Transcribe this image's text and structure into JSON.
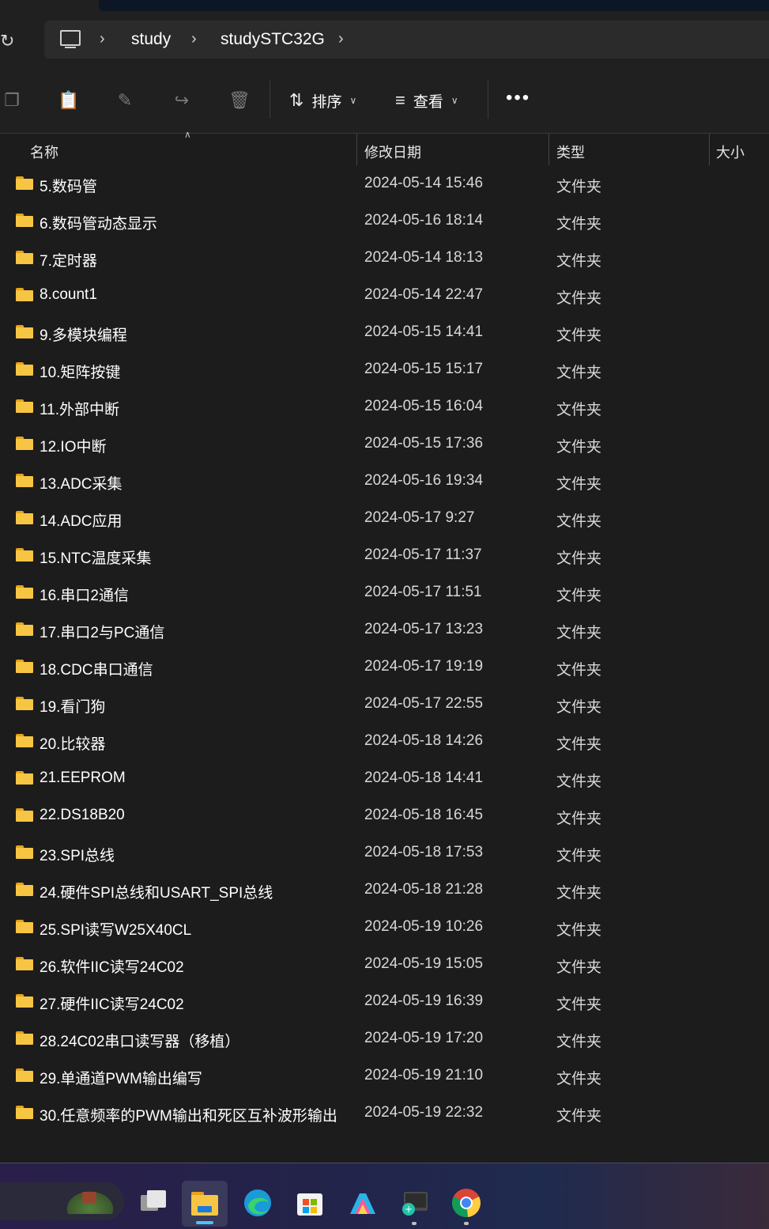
{
  "address": {
    "refresh_icon": "refresh-icon",
    "pc_icon": "computer-icon",
    "breadcrumbs": [
      "study",
      "studySTC32G"
    ]
  },
  "toolbar": {
    "sort_label": "排序",
    "view_label": "查看",
    "icons": [
      "copy-icon",
      "paste-icon",
      "rename-icon",
      "share-icon",
      "delete-icon"
    ]
  },
  "columns": {
    "name": "名称",
    "date": "修改日期",
    "type": "类型",
    "size": "大小"
  },
  "rows": [
    {
      "name": "5.数码管",
      "date": "2024-05-14 15:46",
      "type": "文件夹"
    },
    {
      "name": "6.数码管动态显示",
      "date": "2024-05-16 18:14",
      "type": "文件夹"
    },
    {
      "name": "7.定时器",
      "date": "2024-05-14 18:13",
      "type": "文件夹"
    },
    {
      "name": "8.count1",
      "date": "2024-05-14 22:47",
      "type": "文件夹"
    },
    {
      "name": "9.多模块编程",
      "date": "2024-05-15 14:41",
      "type": "文件夹"
    },
    {
      "name": "10.矩阵按键",
      "date": "2024-05-15 15:17",
      "type": "文件夹"
    },
    {
      "name": "11.外部中断",
      "date": "2024-05-15 16:04",
      "type": "文件夹"
    },
    {
      "name": "12.IO中断",
      "date": "2024-05-15 17:36",
      "type": "文件夹"
    },
    {
      "name": "13.ADC采集",
      "date": "2024-05-16 19:34",
      "type": "文件夹"
    },
    {
      "name": "14.ADC应用",
      "date": "2024-05-17 9:27",
      "type": "文件夹"
    },
    {
      "name": "15.NTC温度采集",
      "date": "2024-05-17 11:37",
      "type": "文件夹"
    },
    {
      "name": "16.串口2通信",
      "date": "2024-05-17 11:51",
      "type": "文件夹"
    },
    {
      "name": "17.串口2与PC通信",
      "date": "2024-05-17 13:23",
      "type": "文件夹"
    },
    {
      "name": "18.CDC串口通信",
      "date": "2024-05-17 19:19",
      "type": "文件夹"
    },
    {
      "name": "19.看门狗",
      "date": "2024-05-17 22:55",
      "type": "文件夹"
    },
    {
      "name": "20.比较器",
      "date": "2024-05-18 14:26",
      "type": "文件夹"
    },
    {
      "name": "21.EEPROM",
      "date": "2024-05-18 14:41",
      "type": "文件夹"
    },
    {
      "name": "22.DS18B20",
      "date": "2024-05-18 16:45",
      "type": "文件夹"
    },
    {
      "name": "23.SPI总线",
      "date": "2024-05-18 17:53",
      "type": "文件夹"
    },
    {
      "name": "24.硬件SPI总线和USART_SPI总线",
      "date": "2024-05-18 21:28",
      "type": "文件夹"
    },
    {
      "name": "25.SPI读写W25X40CL",
      "date": "2024-05-19 10:26",
      "type": "文件夹"
    },
    {
      "name": "26.软件IIC读写24C02",
      "date": "2024-05-19 15:05",
      "type": "文件夹"
    },
    {
      "name": "27.硬件IIC读写24C02",
      "date": "2024-05-19 16:39",
      "type": "文件夹"
    },
    {
      "name": "28.24C02串口读写器（移植）",
      "date": "2024-05-19 17:20",
      "type": "文件夹"
    },
    {
      "name": "29.单通道PWM输出编写",
      "date": "2024-05-19 21:10",
      "type": "文件夹"
    },
    {
      "name": "30.任意频率的PWM输出和死区互补波形输出",
      "date": "2024-05-19 22:32",
      "type": "文件夹"
    }
  ],
  "taskbar": {
    "apps": [
      "task-view-icon",
      "file-explorer-icon",
      "edge-icon",
      "store-icon",
      "photos-icon",
      "snipping-tool-icon",
      "chrome-icon"
    ],
    "active_app": "file-explorer-icon"
  },
  "colors": {
    "background": "#1c1c1c",
    "folder": "#f7c544",
    "accent": "#4cc2ff"
  }
}
